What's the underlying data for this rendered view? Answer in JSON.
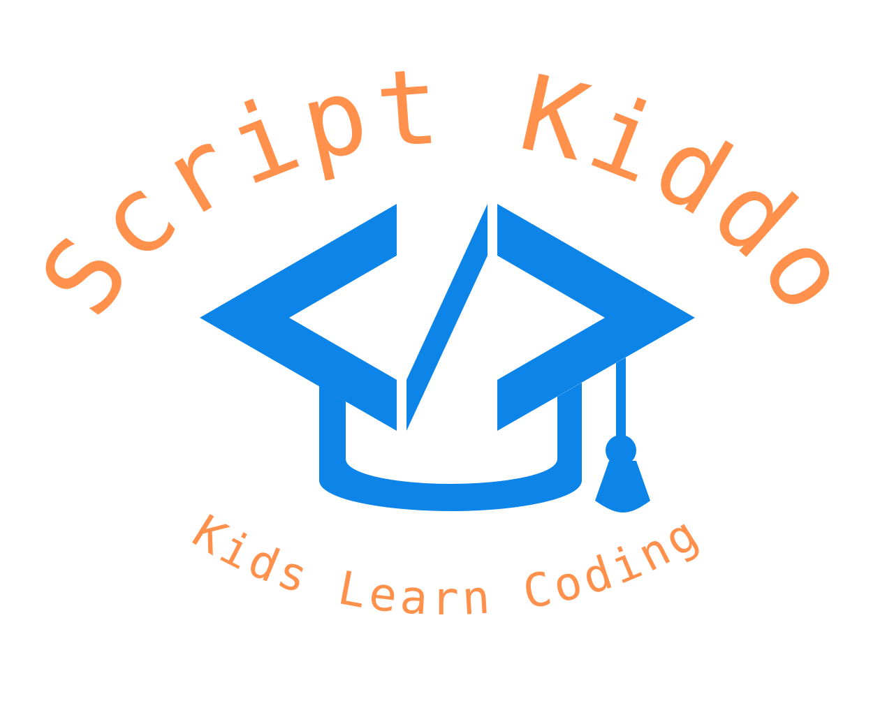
{
  "logo": {
    "brand_name": "Script Kiddo",
    "tagline": "Kids Learn Coding",
    "colors": {
      "text": "#FF914D",
      "cap": "#0C84E8",
      "background": "#FFFFFF"
    },
    "emblem_icon": "graduation-cap-code-icon"
  }
}
